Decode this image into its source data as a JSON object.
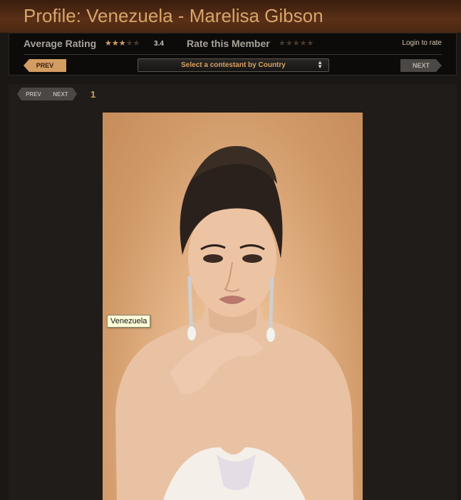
{
  "header": {
    "title": "Profile: Venezuela - Marelisa Gibson"
  },
  "rating": {
    "average_label": "Average Rating",
    "average_value": "3.4",
    "average_stars_filled": 3,
    "average_stars_total": 5,
    "rate_label": "Rate this Member",
    "rate_stars_total": 5,
    "login_text": "Login to rate"
  },
  "nav": {
    "prev_label": "PREV",
    "next_label": "NEXT",
    "select_value": "Select a contestant by Country"
  },
  "gallery": {
    "prev_label": "PREV",
    "next_label": "NEXT",
    "page": "1",
    "tooltip": "Venezuela"
  },
  "colors": {
    "accent": "#d39c62",
    "header_bg": "#4a2712",
    "page_bg": "#1a1714"
  }
}
